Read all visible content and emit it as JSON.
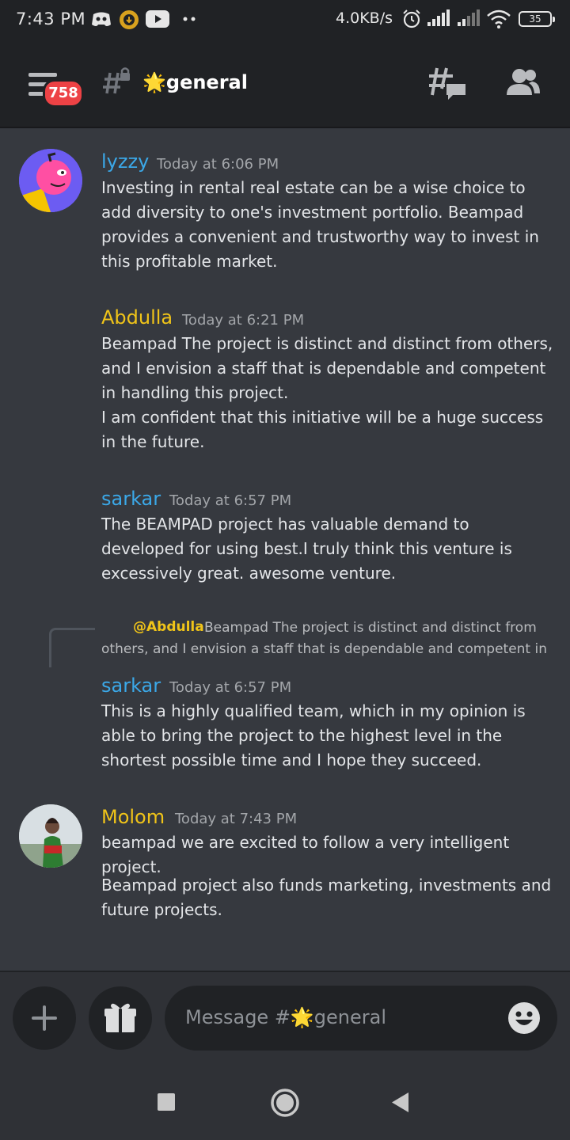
{
  "status_bar": {
    "time": "7:43 PM",
    "network_speed": "4.0KB/s",
    "battery_level": "35",
    "icons": [
      "discord-icon",
      "download-icon",
      "youtube-icon",
      "more-dots-icon",
      "alarm-icon",
      "signal-icon",
      "signal-icon-2",
      "wifi-icon",
      "battery-icon"
    ]
  },
  "header": {
    "notification_count": "758",
    "channel_name": "🌟general",
    "icons": [
      "menu-icon",
      "locked-hashtag-icon",
      "threads-icon",
      "members-icon"
    ]
  },
  "messages": [
    {
      "author": "lyzzy",
      "author_color": "#3ba8e8",
      "timestamp": "Today at 6:06 PM",
      "lines": [
        "Investing in rental real estate can be a wise choice to add diversity to one's investment portfolio. Beampad provides a convenient and trustworthy way to invest in this profitable market."
      ],
      "has_avatar": true
    },
    {
      "author": "Abdulla",
      "author_color": "#f0c419",
      "timestamp": "Today at 6:21 PM",
      "lines": [
        "Beampad The project is distinct and distinct from others, and I envision a staff that is dependable and competent in handling this project.",
        "I am confident that this initiative will be a huge success in the future."
      ],
      "has_avatar": false
    },
    {
      "author": "sarkar",
      "author_color": "#3ba8e8",
      "timestamp": "Today at 6:57 PM",
      "lines": [
        "The BEAMPAD project has valuable demand to developed for using best.I truly think this venture is excessively great. awesome venture."
      ],
      "has_avatar": false
    },
    {
      "reply_to": "@Abdulla",
      "reply_text": "Beampad The project is distinct and distinct from others, and I envision a staff that is dependable and competent in",
      "author": "sarkar",
      "author_color": "#3ba8e8",
      "timestamp": "Today at 6:57 PM",
      "lines": [
        "This is a highly qualified team, which in my opinion is able to bring the project to the highest level in the shortest possible time and I hope they succeed."
      ],
      "has_avatar": false
    },
    {
      "author": "Molom",
      "author_color": "#f0c419",
      "timestamp": "Today at 7:43 PM",
      "lines": [
        "beampad we are excited to follow a very intelligent project.",
        "Beampad  project  also funds marketing, investments and future projects."
      ],
      "has_avatar": true
    }
  ],
  "composer": {
    "placeholder": "Message #🌟general",
    "icons": [
      "plus-icon",
      "gift-icon",
      "emoji-icon"
    ]
  },
  "nav": {
    "icons": [
      "recent-apps-icon",
      "home-icon",
      "back-icon"
    ]
  }
}
